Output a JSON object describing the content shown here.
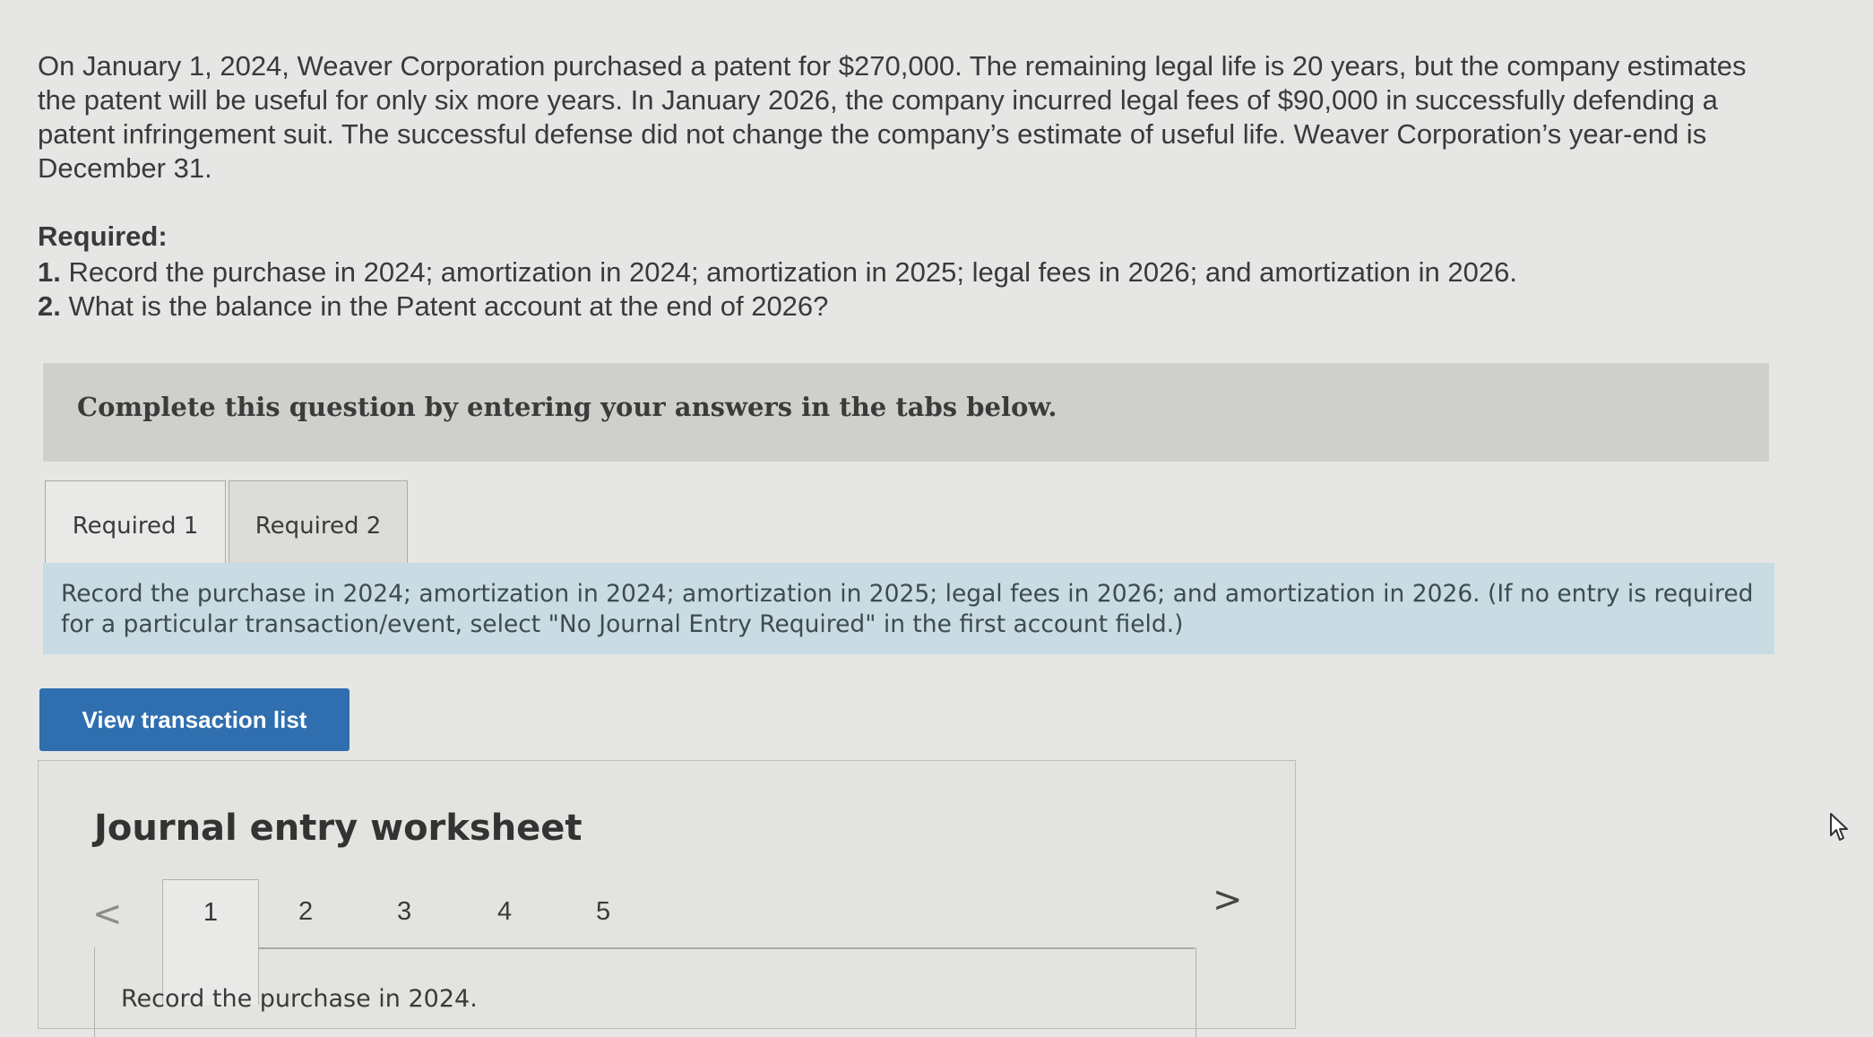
{
  "problem": {
    "paragraph": "On January 1, 2024, Weaver Corporation purchased a patent for $270,000. The remaining legal life is 20 years, but the company estimates the patent will be useful for only six more years. In January 2026, the company incurred legal fees of $90,000 in successfully defending a patent infringement suit. The successful defense did not change the company’s estimate of useful life. Weaver Corporation’s year-end is December 31."
  },
  "required": {
    "heading": "Required:",
    "items": [
      {
        "num": "1.",
        "text": " Record the purchase in 2024; amortization in 2024; amortization in 2025; legal fees in 2026; and amortization in 2026."
      },
      {
        "num": "2.",
        "text": " What is the balance in the Patent account at the end of 2026?"
      }
    ]
  },
  "instruction": "Complete this question by entering your answers in the tabs below.",
  "tabs": [
    {
      "label": "Required 1",
      "active": true
    },
    {
      "label": "Required 2",
      "active": false
    }
  ],
  "task_text": "Record the purchase in 2024; amortization in 2024; amortization in 2025; legal fees in 2026; and amortization in 2026. (If no entry is required for a particular transaction/event, select \"No Journal Entry Required\" in the first account field.)",
  "view_button": "View transaction list",
  "worksheet": {
    "title": "Journal entry worksheet",
    "prev_glyph": "<",
    "next_glyph": ">",
    "steps": [
      "1",
      "2",
      "3",
      "4",
      "5"
    ],
    "active_step": "1",
    "step_text": "Record the purchase in 2024."
  },
  "icons": {
    "prev": "chevron-left-icon",
    "next": "chevron-right-icon",
    "cursor": "mouse-pointer-icon"
  },
  "colors": {
    "button": "#2f6fb0",
    "task_bar": "#c9dbe3",
    "instruction_bar": "#cfcfcb"
  }
}
